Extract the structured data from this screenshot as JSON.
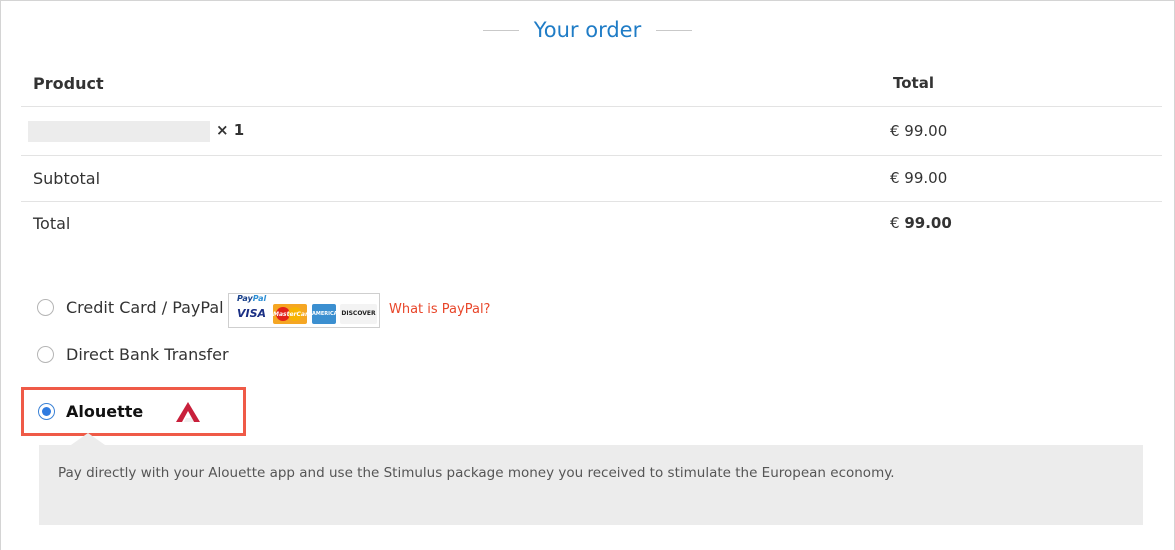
{
  "heading": {
    "title": "Your order"
  },
  "table": {
    "header": {
      "product": "Product",
      "total": "Total"
    },
    "item": {
      "quantity": "× 1",
      "price": "€ 99.00"
    },
    "subtotal": {
      "label": "Subtotal",
      "value": "€ 99.00"
    },
    "total": {
      "label": "Total",
      "currency": "€",
      "value": "99.00"
    }
  },
  "payment": {
    "options": [
      {
        "label": "Credit Card / PayPal",
        "selected": false
      },
      {
        "label": "Direct Bank Transfer",
        "selected": false
      },
      {
        "label": "Alouette",
        "selected": true
      }
    ],
    "paypal_badge": {
      "brand_prefix": "Pay",
      "brand_suffix": "Pal",
      "cards": [
        "VISA",
        "MasterCard",
        "AMERICAN EXPRESS",
        "DISCOVER"
      ]
    },
    "what_is_paypal": "What is PayPal?",
    "alouette_description": "Pay directly with your Alouette app and use the Stimulus package money you received to stimulate the European economy."
  },
  "colors": {
    "accent": "#1f7cc6",
    "link": "#e8462a",
    "highlight_border": "#ef5a47",
    "radio_selected": "#2f7be0",
    "alouette_logo": "#c8203b"
  }
}
